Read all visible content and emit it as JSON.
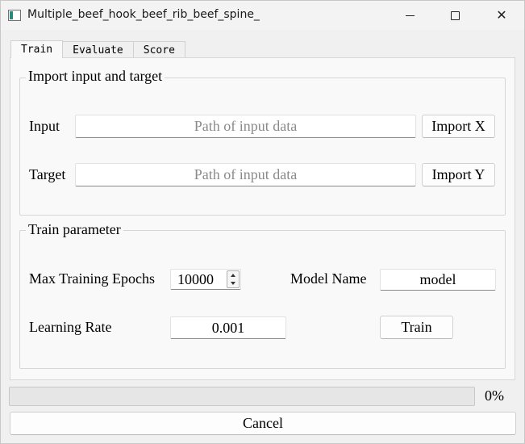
{
  "window": {
    "title": "Multiple_beef_hook_beef_rib_beef_spine_",
    "icon": "app-window-icon",
    "controls": {
      "minimize_icon": "minimize-icon",
      "maximize_icon": "maximize-icon",
      "close_icon": "close-icon",
      "close_glyph": "✕"
    }
  },
  "tabs": [
    {
      "label": "Train",
      "active": true
    },
    {
      "label": "Evaluate",
      "active": false
    },
    {
      "label": "Score",
      "active": false
    }
  ],
  "import_group": {
    "title": "Import input and target",
    "input_label": "Input",
    "input_value": "",
    "input_placeholder": "Path of input data",
    "import_x_label": "Import X",
    "target_label": "Target",
    "target_value": "",
    "target_placeholder": "Path of input data",
    "import_y_label": "Import Y"
  },
  "train_group": {
    "title": "Train parameter",
    "max_epochs_label": "Max Training Epochs",
    "max_epochs_value": "10000",
    "model_name_label": "Model Name",
    "model_name_value": "model",
    "learning_rate_label": "Learning Rate",
    "learning_rate_value": "0.001",
    "train_button_label": "Train"
  },
  "progress": {
    "value": 0,
    "text": "0%",
    "color": "#2a8a3a"
  },
  "cancel_label": "Cancel"
}
